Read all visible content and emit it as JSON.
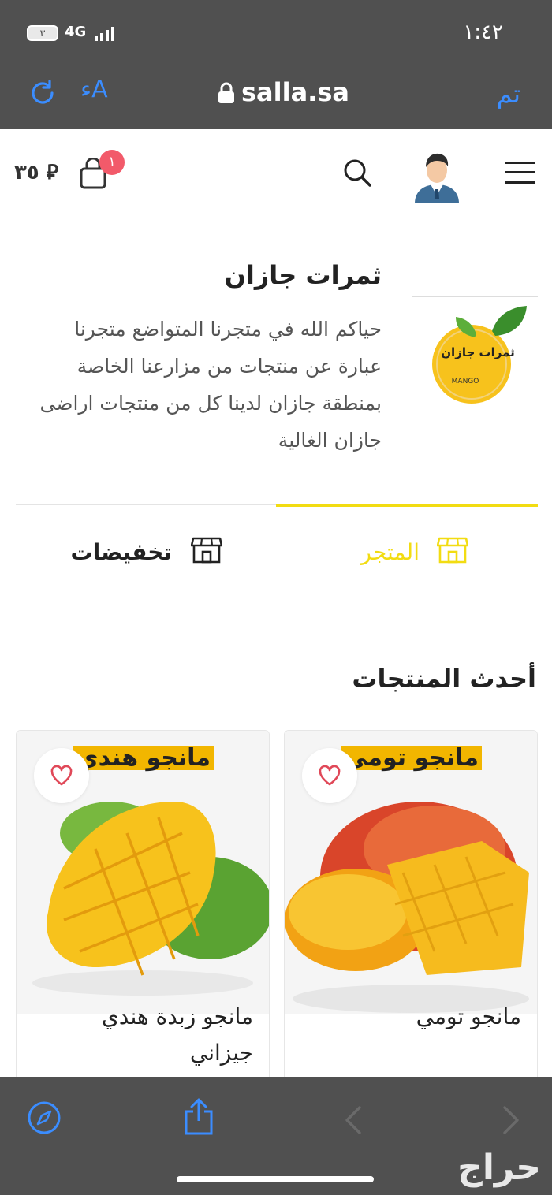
{
  "status_bar": {
    "battery": "٣",
    "network": "4G",
    "time": "١:٤٢"
  },
  "browser": {
    "domain": "salla.sa",
    "text_size_label": "ءA",
    "done_label": "تم"
  },
  "header": {
    "cart_total": "٣٥ ⃁",
    "cart_count": "١"
  },
  "store": {
    "name": "ثمرات جازان",
    "description": "حياكم الله في متجرنا المتواضع متجرنا عبارة عن منتجات من مزارعنا الخاصة بمنطقة جازان لدينا كل من منتجات اراضى جازان الغالية",
    "logo_text": "ثمرات جازان",
    "logo_sub": "MANGO"
  },
  "tabs": [
    {
      "label": "المتجر",
      "active": true
    },
    {
      "label": "تخفيضات",
      "active": false
    }
  ],
  "section": {
    "title": "أحدث المنتجات"
  },
  "products": [
    {
      "name": "مانجو تومي",
      "image_caption": "مانجو تومي"
    },
    {
      "name": "مانجو زبدة هندي جيزاني",
      "image_caption": "مانجو هندي"
    }
  ],
  "colors": {
    "accent_yellow": "#f2dc12",
    "badge_red": "#f25a6a",
    "browser_blue": "#3b8dff",
    "chrome_gray": "#505050"
  },
  "watermark": "حراج"
}
